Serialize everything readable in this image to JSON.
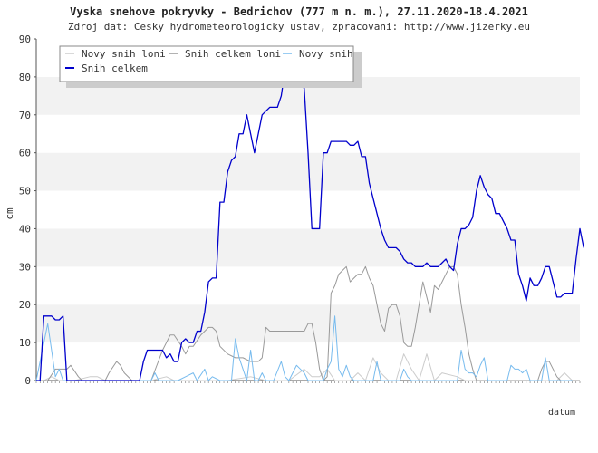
{
  "chart_data": {
    "type": "line",
    "title": "Vyska snehove pokryvky - Bedrichov (777 m n. m.), 27.11.2020-18.4.2021",
    "subtitle": "Zdroj dat: Cesky hydrometeorologicky ustav, zpracovani: http://www.jizerky.eu",
    "ylabel": "cm",
    "xlabel": "datum",
    "ylim": [
      0,
      90
    ],
    "yticks": [
      0,
      10,
      20,
      30,
      40,
      50,
      60,
      70,
      80,
      90
    ],
    "grid": "horizontal bands",
    "legend_position": "top-left",
    "x_count": 143,
    "series": [
      {
        "name": "Novy snih loni",
        "color": "#cccccc",
        "points": [
          [
            0,
            0
          ],
          [
            2,
            0
          ],
          [
            4,
            1
          ],
          [
            6,
            0
          ],
          [
            10,
            0
          ],
          [
            14,
            1
          ],
          [
            16,
            1
          ],
          [
            18,
            0
          ],
          [
            30,
            0
          ],
          [
            34,
            1
          ],
          [
            36,
            0
          ],
          [
            46,
            0
          ],
          [
            48,
            0
          ],
          [
            50,
            0
          ],
          [
            56,
            1
          ],
          [
            60,
            0
          ],
          [
            66,
            0
          ],
          [
            70,
            3
          ],
          [
            72,
            1
          ],
          [
            74,
            1
          ],
          [
            76,
            3
          ],
          [
            78,
            0
          ],
          [
            80,
            0
          ],
          [
            82,
            0
          ],
          [
            84,
            2
          ],
          [
            86,
            0
          ],
          [
            88,
            6
          ],
          [
            90,
            2
          ],
          [
            92,
            0
          ],
          [
            94,
            0
          ],
          [
            96,
            7
          ],
          [
            98,
            3
          ],
          [
            100,
            0
          ],
          [
            102,
            7
          ],
          [
            104,
            0
          ],
          [
            106,
            2
          ],
          [
            110,
            1
          ],
          [
            112,
            0
          ],
          [
            125,
            0
          ],
          [
            130,
            0
          ],
          [
            134,
            0
          ],
          [
            136,
            0
          ],
          [
            138,
            2
          ],
          [
            140,
            0
          ],
          [
            142,
            0
          ]
        ]
      },
      {
        "name": "Snih celkem loni",
        "color": "#999999",
        "points": [
          [
            0,
            0
          ],
          [
            3,
            0
          ],
          [
            5,
            3
          ],
          [
            8,
            3
          ],
          [
            9,
            4
          ],
          [
            11,
            1
          ],
          [
            12,
            0
          ],
          [
            18,
            0
          ],
          [
            19,
            2
          ],
          [
            21,
            5
          ],
          [
            22,
            4
          ],
          [
            23,
            2
          ],
          [
            25,
            0
          ],
          [
            30,
            0
          ],
          [
            33,
            8
          ],
          [
            35,
            12
          ],
          [
            36,
            12
          ],
          [
            38,
            9
          ],
          [
            39,
            7
          ],
          [
            40,
            9
          ],
          [
            41,
            9
          ],
          [
            43,
            12
          ],
          [
            45,
            14
          ],
          [
            46,
            14
          ],
          [
            47,
            13
          ],
          [
            48,
            9
          ],
          [
            50,
            7
          ],
          [
            52,
            6
          ],
          [
            54,
            6
          ],
          [
            56,
            5
          ],
          [
            58,
            5
          ],
          [
            59,
            6
          ],
          [
            60,
            14
          ],
          [
            61,
            13
          ],
          [
            62,
            13
          ],
          [
            70,
            13
          ],
          [
            71,
            15
          ],
          [
            72,
            15
          ],
          [
            73,
            10
          ],
          [
            74,
            3
          ],
          [
            75,
            0
          ],
          [
            76,
            1
          ],
          [
            77,
            23
          ],
          [
            78,
            25
          ],
          [
            79,
            28
          ],
          [
            80,
            29
          ],
          [
            81,
            30
          ],
          [
            82,
            26
          ],
          [
            83,
            27
          ],
          [
            84,
            28
          ],
          [
            85,
            28
          ],
          [
            86,
            30
          ],
          [
            87,
            27
          ],
          [
            88,
            25
          ],
          [
            89,
            20
          ],
          [
            90,
            15
          ],
          [
            91,
            13
          ],
          [
            92,
            19
          ],
          [
            93,
            20
          ],
          [
            94,
            20
          ],
          [
            95,
            17
          ],
          [
            96,
            10
          ],
          [
            97,
            9
          ],
          [
            98,
            9
          ],
          [
            99,
            14
          ],
          [
            100,
            20
          ],
          [
            101,
            26
          ],
          [
            102,
            22
          ],
          [
            103,
            18
          ],
          [
            104,
            25
          ],
          [
            105,
            24
          ],
          [
            106,
            26
          ],
          [
            107,
            28
          ],
          [
            108,
            30
          ],
          [
            109,
            30
          ],
          [
            110,
            28
          ],
          [
            111,
            20
          ],
          [
            112,
            14
          ],
          [
            113,
            7
          ],
          [
            114,
            3
          ],
          [
            115,
            0
          ],
          [
            131,
            0
          ],
          [
            132,
            3
          ],
          [
            133,
            5
          ],
          [
            134,
            5
          ],
          [
            135,
            3
          ],
          [
            136,
            1
          ],
          [
            137,
            0
          ],
          [
            142,
            0
          ]
        ]
      },
      {
        "name": "Novy snih",
        "color": "#77bbee",
        "points": [
          [
            0,
            0
          ],
          [
            2,
            10
          ],
          [
            3,
            15
          ],
          [
            4,
            8
          ],
          [
            5,
            1
          ],
          [
            6,
            3
          ],
          [
            7,
            0
          ],
          [
            30,
            0
          ],
          [
            31,
            2
          ],
          [
            32,
            0
          ],
          [
            37,
            0
          ],
          [
            39,
            1
          ],
          [
            41,
            2
          ],
          [
            42,
            0
          ],
          [
            44,
            3
          ],
          [
            45,
            0
          ],
          [
            46,
            1
          ],
          [
            48,
            0
          ],
          [
            51,
            0
          ],
          [
            52,
            11
          ],
          [
            53,
            6
          ],
          [
            54,
            3
          ],
          [
            55,
            0
          ],
          [
            56,
            8
          ],
          [
            57,
            0
          ],
          [
            58,
            0
          ],
          [
            59,
            2
          ],
          [
            60,
            0
          ],
          [
            62,
            0
          ],
          [
            64,
            5
          ],
          [
            65,
            1
          ],
          [
            66,
            0
          ],
          [
            68,
            4
          ],
          [
            69,
            3
          ],
          [
            70,
            2
          ],
          [
            71,
            0
          ],
          [
            75,
            0
          ],
          [
            76,
            3
          ],
          [
            77,
            5
          ],
          [
            78,
            17
          ],
          [
            79,
            3
          ],
          [
            80,
            1
          ],
          [
            81,
            4
          ],
          [
            82,
            1
          ],
          [
            83,
            0
          ],
          [
            88,
            0
          ],
          [
            89,
            5
          ],
          [
            90,
            0
          ],
          [
            95,
            0
          ],
          [
            96,
            3
          ],
          [
            97,
            1
          ],
          [
            98,
            0
          ],
          [
            110,
            0
          ],
          [
            111,
            8
          ],
          [
            112,
            3
          ],
          [
            113,
            2
          ],
          [
            114,
            2
          ],
          [
            115,
            1
          ],
          [
            116,
            4
          ],
          [
            117,
            6
          ],
          [
            118,
            0
          ],
          [
            123,
            0
          ],
          [
            124,
            4
          ],
          [
            125,
            3
          ],
          [
            126,
            3
          ],
          [
            127,
            2
          ],
          [
            128,
            3
          ],
          [
            129,
            0
          ],
          [
            132,
            0
          ],
          [
            133,
            6
          ],
          [
            134,
            0
          ],
          [
            136,
            0
          ],
          [
            138,
            0
          ],
          [
            140,
            0
          ]
        ]
      },
      {
        "name": "Snih celkem",
        "color": "#0000cc",
        "points": [
          [
            0,
            0
          ],
          [
            1,
            0
          ],
          [
            2,
            17
          ],
          [
            4,
            17
          ],
          [
            5,
            16
          ],
          [
            6,
            16
          ],
          [
            7,
            17
          ],
          [
            8,
            0
          ],
          [
            27,
            0
          ],
          [
            28,
            5
          ],
          [
            29,
            8
          ],
          [
            33,
            8
          ],
          [
            34,
            6
          ],
          [
            35,
            7
          ],
          [
            36,
            5
          ],
          [
            37,
            5
          ],
          [
            38,
            10
          ],
          [
            39,
            11
          ],
          [
            40,
            10
          ],
          [
            41,
            10
          ],
          [
            42,
            13
          ],
          [
            43,
            13
          ],
          [
            44,
            18
          ],
          [
            45,
            26
          ],
          [
            46,
            27
          ],
          [
            47,
            27
          ],
          [
            48,
            47
          ],
          [
            49,
            47
          ],
          [
            50,
            55
          ],
          [
            51,
            58
          ],
          [
            52,
            59
          ],
          [
            53,
            65
          ],
          [
            54,
            65
          ],
          [
            55,
            70
          ],
          [
            56,
            65
          ],
          [
            57,
            60
          ],
          [
            58,
            65
          ],
          [
            59,
            70
          ],
          [
            60,
            71
          ],
          [
            61,
            72
          ],
          [
            62,
            72
          ],
          [
            63,
            72
          ],
          [
            64,
            75
          ],
          [
            65,
            82
          ],
          [
            66,
            83
          ],
          [
            67,
            82
          ],
          [
            68,
            80
          ],
          [
            69,
            78
          ],
          [
            70,
            77
          ],
          [
            71,
            60
          ],
          [
            72,
            40
          ],
          [
            73,
            40
          ],
          [
            74,
            40
          ],
          [
            75,
            60
          ],
          [
            76,
            60
          ],
          [
            77,
            63
          ],
          [
            78,
            63
          ],
          [
            79,
            63
          ],
          [
            80,
            63
          ],
          [
            81,
            63
          ],
          [
            82,
            62
          ],
          [
            83,
            62
          ],
          [
            84,
            63
          ],
          [
            85,
            59
          ],
          [
            86,
            59
          ],
          [
            87,
            52
          ],
          [
            88,
            48
          ],
          [
            89,
            44
          ],
          [
            90,
            40
          ],
          [
            91,
            37
          ],
          [
            92,
            35
          ],
          [
            93,
            35
          ],
          [
            94,
            35
          ],
          [
            95,
            34
          ],
          [
            96,
            32
          ],
          [
            97,
            31
          ],
          [
            98,
            31
          ],
          [
            99,
            30
          ],
          [
            100,
            30
          ],
          [
            101,
            30
          ],
          [
            102,
            31
          ],
          [
            103,
            30
          ],
          [
            104,
            30
          ],
          [
            105,
            30
          ],
          [
            106,
            31
          ],
          [
            107,
            32
          ],
          [
            108,
            30
          ],
          [
            109,
            29
          ],
          [
            110,
            36
          ],
          [
            111,
            40
          ],
          [
            112,
            40
          ],
          [
            113,
            41
          ],
          [
            114,
            43
          ],
          [
            115,
            50
          ],
          [
            116,
            54
          ],
          [
            117,
            51
          ],
          [
            118,
            49
          ],
          [
            119,
            48
          ],
          [
            120,
            44
          ],
          [
            121,
            44
          ],
          [
            122,
            42
          ],
          [
            123,
            40
          ],
          [
            124,
            37
          ],
          [
            125,
            37
          ],
          [
            126,
            28
          ],
          [
            127,
            25
          ],
          [
            128,
            21
          ],
          [
            129,
            27
          ],
          [
            130,
            25
          ],
          [
            131,
            25
          ],
          [
            132,
            27
          ],
          [
            133,
            30
          ],
          [
            134,
            30
          ],
          [
            135,
            26
          ],
          [
            136,
            22
          ],
          [
            137,
            22
          ],
          [
            138,
            23
          ],
          [
            139,
            23
          ],
          [
            140,
            23
          ],
          [
            141,
            32
          ],
          [
            142,
            40
          ],
          [
            143,
            35
          ]
        ]
      }
    ]
  }
}
